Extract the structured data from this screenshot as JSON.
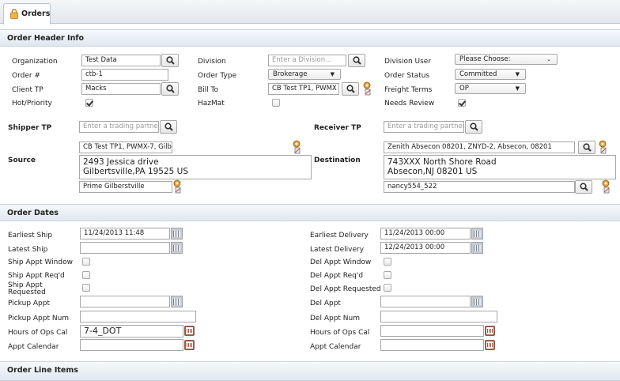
{
  "tab": {
    "label": "Orders",
    "icon": "lock-icon"
  },
  "header_section": {
    "title": "Order Header Info",
    "organization": {
      "label": "Organization",
      "value": "Test Data"
    },
    "order_num": {
      "label": "Order #",
      "value": "ctb-1"
    },
    "client_tp": {
      "label": "Client TP",
      "value": "Macks"
    },
    "hot_priority": {
      "label": "Hot/Priority",
      "checked": true
    },
    "division": {
      "label": "Division",
      "placeholder": "Enter a Division..."
    },
    "order_type": {
      "label": "Order Type",
      "value": "Brokerage"
    },
    "bill_to": {
      "label": "Bill To",
      "value": "CB Test TP1, PWMX"
    },
    "hazmat": {
      "label": "HazMat",
      "checked": false
    },
    "division_user": {
      "label": "Division User",
      "value": "Please Choose:"
    },
    "order_status": {
      "label": "Order Status",
      "value": "Committed"
    },
    "freight_terms": {
      "label": "Freight Terms",
      "value": "OP"
    },
    "needs_review": {
      "label": "Needs Review",
      "checked": true
    },
    "shipper_tp": {
      "label": "Shipper TP",
      "placeholder": "Enter a trading partner"
    },
    "receiver_tp": {
      "label": "Receiver TP",
      "placeholder": "Enter a trading partner"
    },
    "source": {
      "label": "Source",
      "location": "CB Test TP1, PWMX-7, Gilb",
      "address": "2493 Jessica drive\nGilbertsville,PA 19525 US",
      "contact": "Prime Gilberstville"
    },
    "destination": {
      "label": "Destination",
      "location": "Zenith Absecon 08201, ZNYD-2, Absecon, 08201",
      "address": "743XXX North Shore Road\nAbsecon,NJ 08201 US",
      "contact": "nancy554_522"
    }
  },
  "dates_section": {
    "title": "Order Dates",
    "earliest_ship": {
      "label": "Earliest Ship",
      "value": "11/24/2013 11:48"
    },
    "latest_ship": {
      "label": "Latest Ship",
      "value": ""
    },
    "ship_appt_window": {
      "label": "Ship Appt Window",
      "checked": false
    },
    "ship_appt_reqd": {
      "label": "Ship Appt Req'd",
      "checked": false
    },
    "ship_appt_requested": {
      "label": "Ship Appt Requested",
      "checked": false
    },
    "pickup_appt": {
      "label": "Pickup Appt",
      "value": ""
    },
    "pickup_appt_num": {
      "label": "Pickup Appt Num",
      "value": ""
    },
    "hours_ops_cal_left": {
      "label": "Hours of Ops Cal",
      "value": "7-4_DOT"
    },
    "appt_calendar_left": {
      "label": "Appt Calendar",
      "value": ""
    },
    "earliest_delivery": {
      "label": "Earliest Delivery",
      "value": "11/24/2013 00:00"
    },
    "latest_delivery": {
      "label": "Latest Delivery",
      "value": "12/24/2013 00:00"
    },
    "del_appt_window": {
      "label": "Del Appt Window",
      "checked": false
    },
    "del_appt_reqd": {
      "label": "Del Appt Req'd",
      "checked": false
    },
    "del_appt_requested": {
      "label": "Del Appt Requested",
      "checked": false
    },
    "del_appt": {
      "label": "Del Appt",
      "value": ""
    },
    "del_appt_num": {
      "label": "Del Appt Num",
      "value": ""
    },
    "hours_ops_cal_right": {
      "label": "Hours of Ops Cal",
      "value": ""
    },
    "appt_calendar_right": {
      "label": "Appt Calendar",
      "value": ""
    }
  },
  "line_items_section": {
    "title": "Order Line Items"
  },
  "colors": {
    "header_gradient_top": "#f6f9fc",
    "header_gradient_bottom": "#dfe7ef",
    "calendar_red": "#9a5a46"
  }
}
